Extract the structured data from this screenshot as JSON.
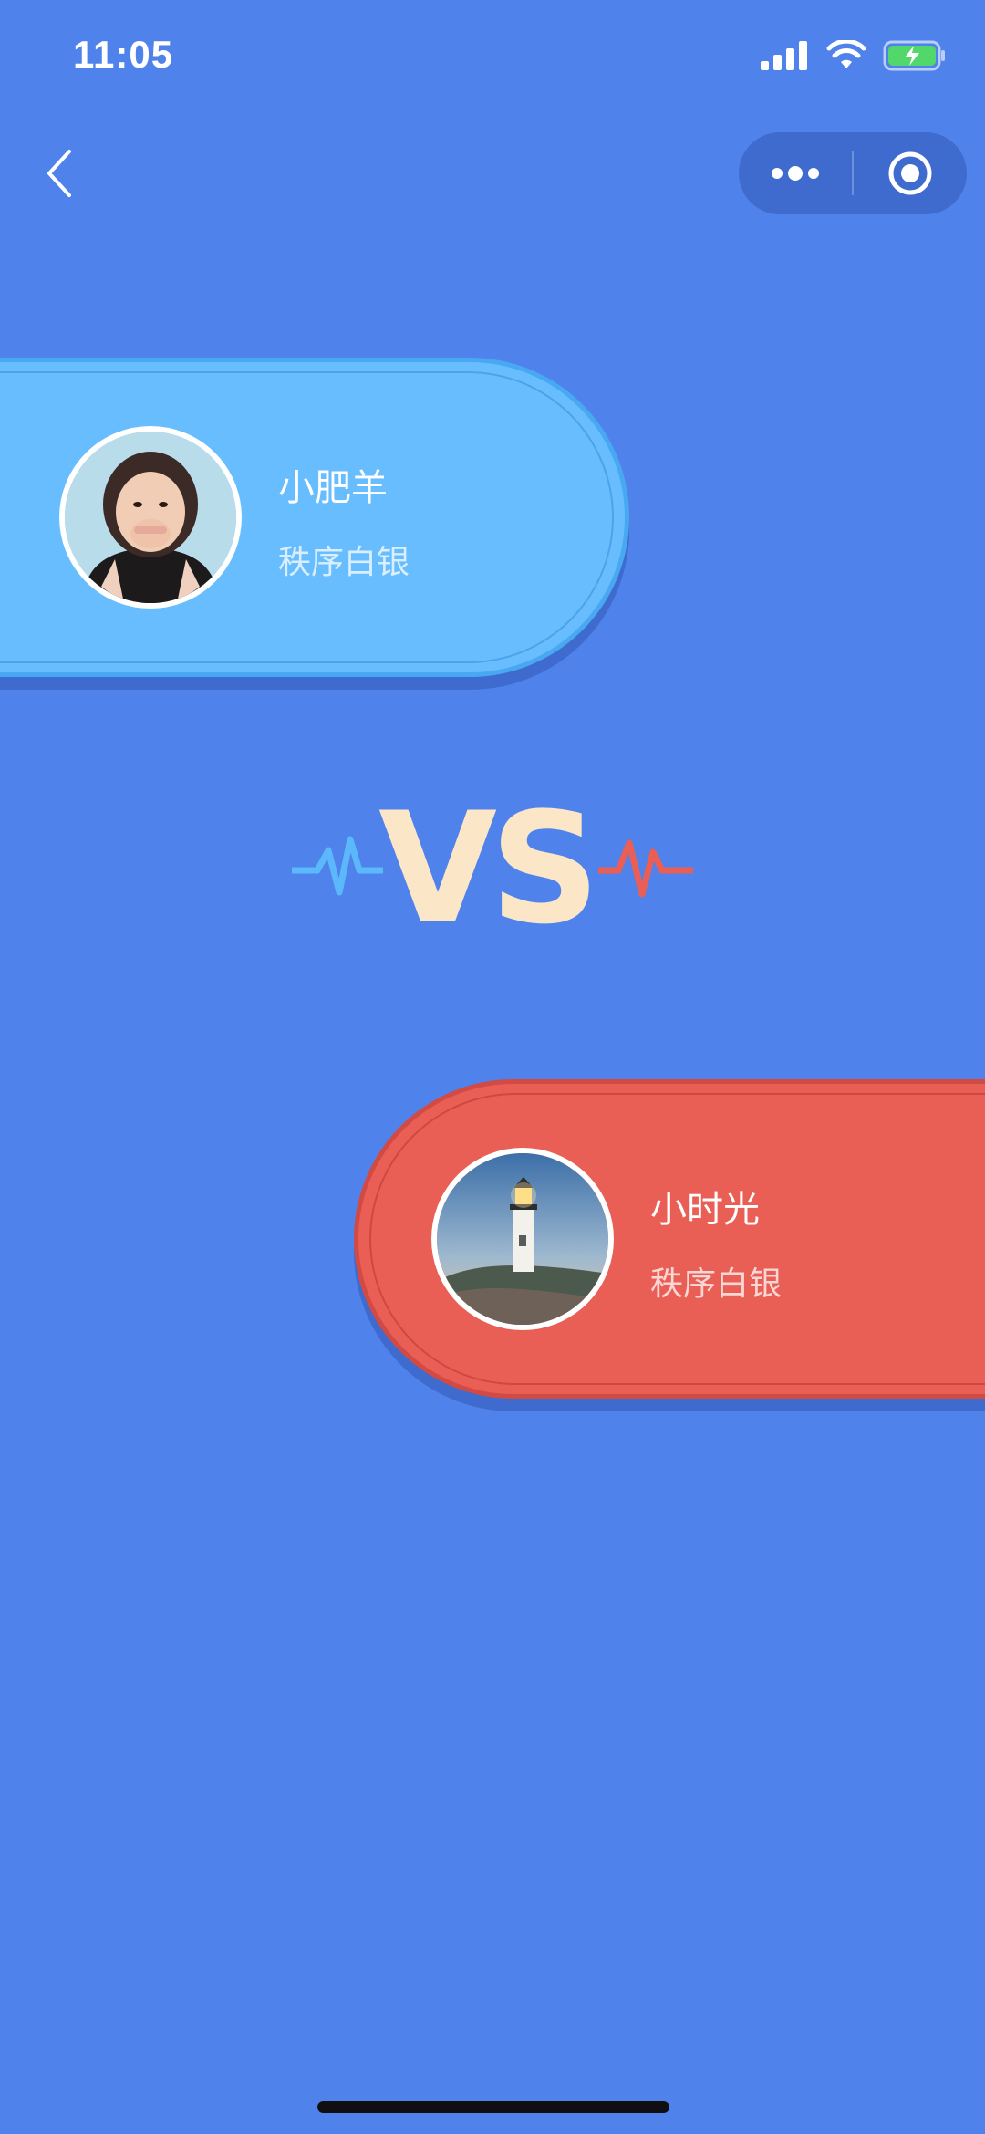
{
  "status_bar": {
    "time": "11:05"
  },
  "nav": {
    "back_icon": "chevron-left-icon",
    "menu_icon": "more-dots-icon",
    "close_icon": "target-circle-icon"
  },
  "players": {
    "left": {
      "name": "小肥羊",
      "rank": "秩序白银",
      "avatar": "girl-portrait",
      "color": "#67BDFD"
    },
    "right": {
      "name": "小时光",
      "rank": "秩序白银",
      "avatar": "lighthouse-photo",
      "color": "#EA5F55"
    }
  },
  "versus": {
    "label": "VS",
    "text_color": "#FBE6C8",
    "left_pulse_color": "#5BB8FA",
    "right_pulse_color": "#EA5F55"
  },
  "colors": {
    "background": "#4F82EA"
  }
}
